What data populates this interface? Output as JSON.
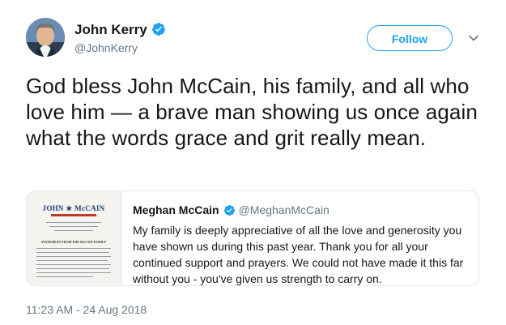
{
  "tweet": {
    "author": {
      "name": "John Kerry",
      "handle": "@JohnKerry",
      "verified": true
    },
    "follow_label": "Follow",
    "text": "God bless John McCain, his family, and all who love him — a brave man showing us once again what the words grace and grit really mean.",
    "timestamp": "11:23 AM - 24 Aug 2018",
    "quoted": {
      "name": "Meghan McCain",
      "handle": "@MeghanMcCain",
      "verified": true,
      "text": "My family is deeply appreciative of all the love and generosity you have shown us during this past year. Thank you for all your continued support and prayers. We could not have made it this far without you - you've given us strength to carry on.",
      "thumbnail": {
        "logo_text": "JOHN ★ McCAIN",
        "heading": "STATEMENT FROM THE McCAIN FAMILY"
      }
    }
  },
  "colors": {
    "accent": "#1da1f2",
    "secondary_text": "#657786",
    "border": "#e1e8ed"
  },
  "icons": [
    "verified-badge-icon",
    "chevron-down-icon"
  ]
}
